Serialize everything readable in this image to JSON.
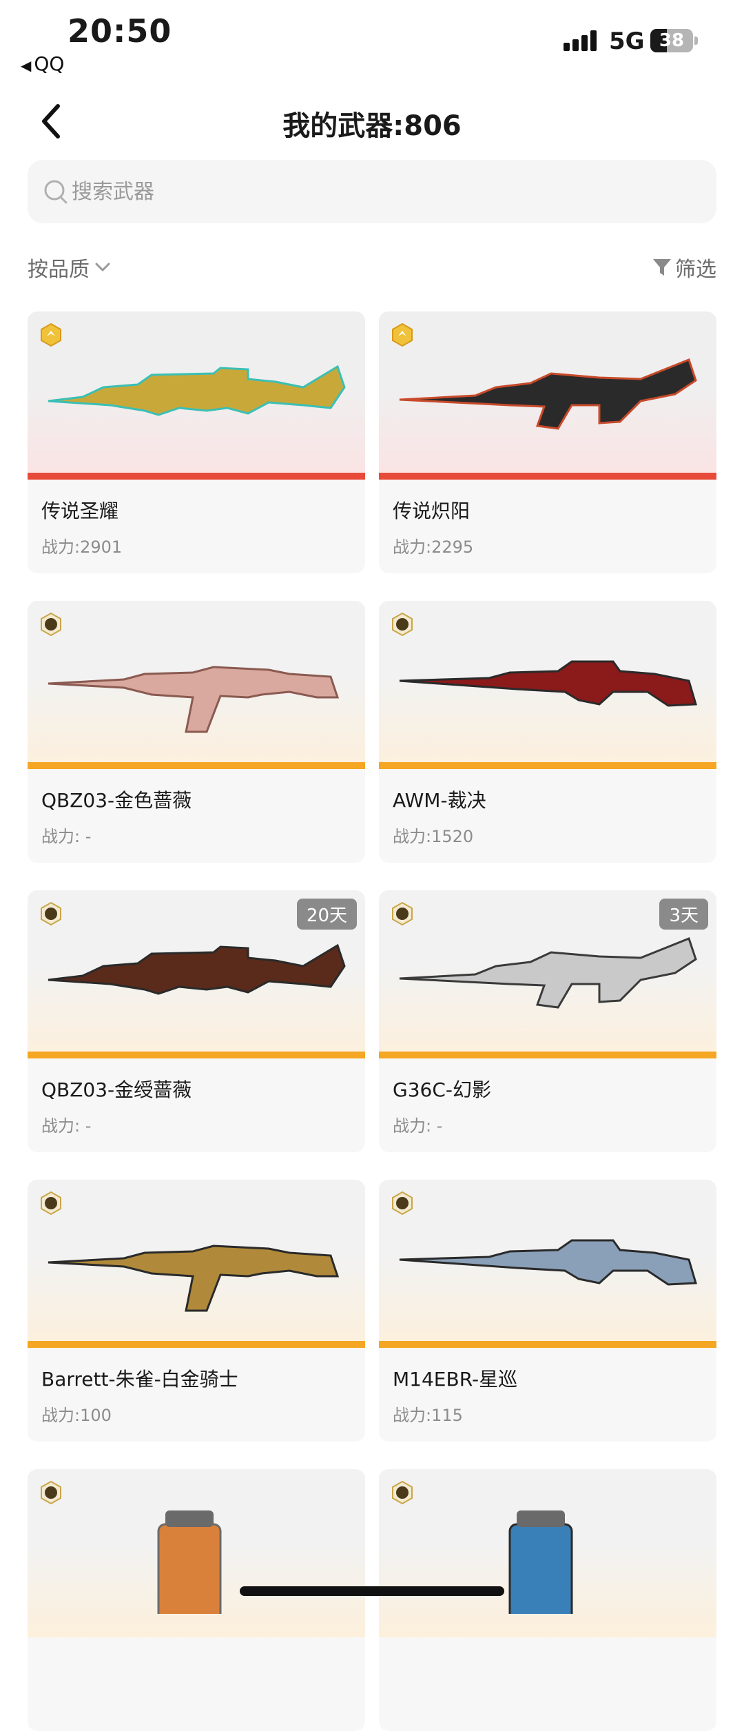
{
  "status_bar": {
    "time": "20:50",
    "back_app": "QQ",
    "network": "5G",
    "battery": "38"
  },
  "header": {
    "title": "我的武器:806"
  },
  "search": {
    "placeholder": "搜索武器"
  },
  "toolbar": {
    "sort_label": "按品质",
    "filter_label": "筛选"
  },
  "weapons": [
    {
      "name": "传说圣耀",
      "power": "战力:2901",
      "days": "",
      "tier": "legend",
      "accent": "#e84a3a"
    },
    {
      "name": "传说炽阳",
      "power": "战力:2295",
      "days": "",
      "tier": "legend",
      "accent": "#e84a3a"
    },
    {
      "name": "QBZ03-金色蔷薇",
      "power": "战力: -",
      "days": "",
      "tier": "v",
      "accent": "#f5a623"
    },
    {
      "name": "AWM-裁决",
      "power": "战力:1520",
      "days": "",
      "tier": "v",
      "accent": "#f5a623"
    },
    {
      "name": "QBZ03-金绶蔷薇",
      "power": "战力: -",
      "days": "20天",
      "tier": "v",
      "accent": "#f5a623"
    },
    {
      "name": "G36C-幻影",
      "power": "战力: -",
      "days": "3天",
      "tier": "v",
      "accent": "#f5a623"
    },
    {
      "name": "Barrett-朱雀-白金骑士",
      "power": "战力:100",
      "days": "",
      "tier": "v",
      "accent": "#f5a623"
    },
    {
      "name": "M14EBR-星巡",
      "power": "战力:115",
      "days": "",
      "tier": "v",
      "accent": "#f5a623"
    },
    {
      "name": "",
      "power": "",
      "days": "",
      "tier": "v",
      "accent": "#f5a623"
    },
    {
      "name": "",
      "power": "",
      "days": "",
      "tier": "v",
      "accent": "#f5a623"
    }
  ]
}
